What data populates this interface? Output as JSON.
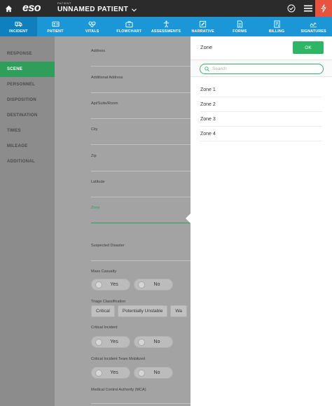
{
  "header": {
    "logo": "eso",
    "patient_caption": "PATIENT",
    "patient_name": "UNNAMED PATIENT"
  },
  "tabs": [
    {
      "label": "INCIDENT",
      "icon": "ambulance-icon",
      "active": true
    },
    {
      "label": "PATIENT",
      "icon": "id-card-icon",
      "active": false
    },
    {
      "label": "VITALS",
      "icon": "heartbeat-icon",
      "active": false
    },
    {
      "label": "FLOWCHART",
      "icon": "briefcase-icon",
      "active": false
    },
    {
      "label": "ASSESSMENTS",
      "icon": "body-icon",
      "active": false
    },
    {
      "label": "NARRATIVE",
      "icon": "pencil-icon",
      "active": false
    },
    {
      "label": "FORMS",
      "icon": "document-icon",
      "active": false
    },
    {
      "label": "BILLING",
      "icon": "billing-icon",
      "active": false
    },
    {
      "label": "SIGNATURES",
      "icon": "signature-icon",
      "active": false
    }
  ],
  "sidenav": {
    "items": [
      {
        "label": "RESPONSE",
        "active": false
      },
      {
        "label": "SCENE",
        "active": true
      },
      {
        "label": "PERSONNEL",
        "active": false
      },
      {
        "label": "DISPOSITION",
        "active": false
      },
      {
        "label": "DESTINATION",
        "active": false
      },
      {
        "label": "TIMES",
        "active": false
      },
      {
        "label": "MILEAGE",
        "active": false
      },
      {
        "label": "ADDITIONAL",
        "active": false
      }
    ]
  },
  "form": {
    "address": "Address",
    "additional_address": "Additional Address",
    "apt": "Apt/Suite/Room",
    "city": "City",
    "zip": "Zip",
    "latitude": "Latitude",
    "zone": "Zone",
    "suspected_disaster": "Suspected Disaster",
    "mass_casualty": "Mass Casualty",
    "triage_classification": "Triage Classification",
    "triage_options": [
      "Critical",
      "Potentially Unstable",
      "Wa"
    ],
    "critical_incident": "Critical Incident",
    "critical_incident_team": "Critical Incident Team Mobilized",
    "medical_control_authority": "Medical Control Authority (MCA)",
    "yes": "Yes",
    "no": "No"
  },
  "zone_panel": {
    "title": "Zone",
    "ok_label": "OK",
    "search_placeholder": "Search",
    "options": [
      "Zone 1",
      "Zone 2",
      "Zone 3",
      "Zone 4"
    ]
  },
  "colors": {
    "topbar": "#2b2b2b",
    "tabbar": "#1b97d8",
    "accent_green": "#2fb566",
    "alert_red": "#e8533f"
  }
}
